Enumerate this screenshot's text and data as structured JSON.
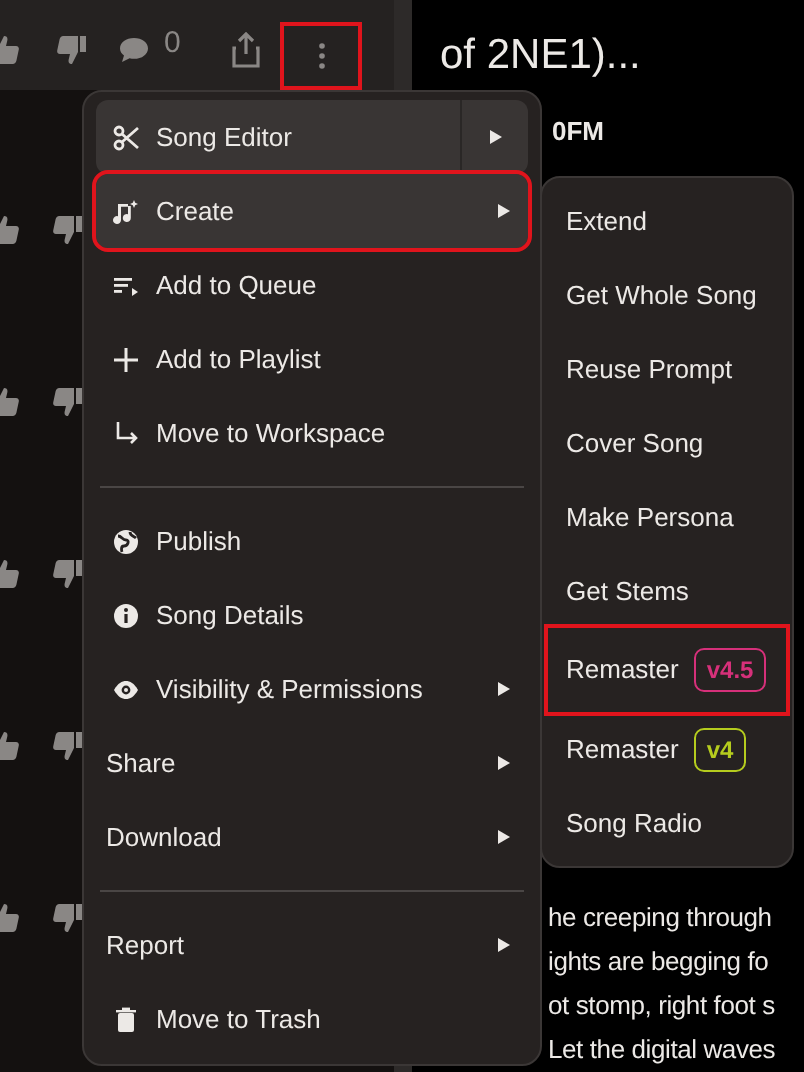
{
  "toolbar": {
    "comment_count": "0",
    "more_outlined": true
  },
  "background": {
    "title": "of 2NE1)...",
    "subtitle": "0FM",
    "lyrics": [
      "he creeping through",
      "ights are begging fo",
      "ot stomp, right foot s",
      "Let the digital waves"
    ]
  },
  "menu": {
    "items": [
      {
        "kind": "split",
        "label": "Song Editor",
        "highlighted": true,
        "outlined": false,
        "submenu": true
      },
      {
        "kind": "item",
        "label": "Create",
        "highlighted": true,
        "outlined": true,
        "submenu": true
      },
      {
        "kind": "item",
        "label": "Add to Queue",
        "highlighted": false,
        "outlined": false,
        "submenu": false
      },
      {
        "kind": "item",
        "label": "Add to Playlist",
        "highlighted": false,
        "outlined": false,
        "submenu": false
      },
      {
        "kind": "item",
        "label": "Move to Workspace",
        "highlighted": false,
        "outlined": false,
        "submenu": false
      },
      {
        "kind": "divider"
      },
      {
        "kind": "item",
        "label": "Publish",
        "highlighted": false,
        "outlined": false,
        "submenu": false
      },
      {
        "kind": "item",
        "label": "Song Details",
        "highlighted": false,
        "outlined": false,
        "submenu": false
      },
      {
        "kind": "item",
        "label": "Visibility & Permissions",
        "highlighted": false,
        "outlined": false,
        "submenu": true
      },
      {
        "kind": "plain",
        "label": "Share",
        "highlighted": false,
        "outlined": false,
        "submenu": true
      },
      {
        "kind": "plain",
        "label": "Download",
        "highlighted": false,
        "outlined": false,
        "submenu": true
      },
      {
        "kind": "divider"
      },
      {
        "kind": "plain",
        "label": "Report",
        "highlighted": false,
        "outlined": false,
        "submenu": true
      },
      {
        "kind": "item",
        "label": "Move to Trash",
        "highlighted": false,
        "outlined": false,
        "submenu": false
      }
    ]
  },
  "submenu": {
    "items": [
      {
        "label": "Extend",
        "outlined": false
      },
      {
        "label": "Get Whole Song",
        "outlined": false
      },
      {
        "label": "Reuse Prompt",
        "outlined": false
      },
      {
        "label": "Cover Song",
        "outlined": false
      },
      {
        "label": "Make Persona",
        "outlined": false
      },
      {
        "label": "Get Stems",
        "outlined": false
      },
      {
        "label": "Remaster",
        "badge": "v4.5",
        "color": "#d6307a",
        "outlined": true
      },
      {
        "label": "Remaster",
        "badge": "v4",
        "color": "#b5cc1e",
        "outlined": false
      },
      {
        "label": "Song Radio",
        "outlined": false
      }
    ]
  }
}
